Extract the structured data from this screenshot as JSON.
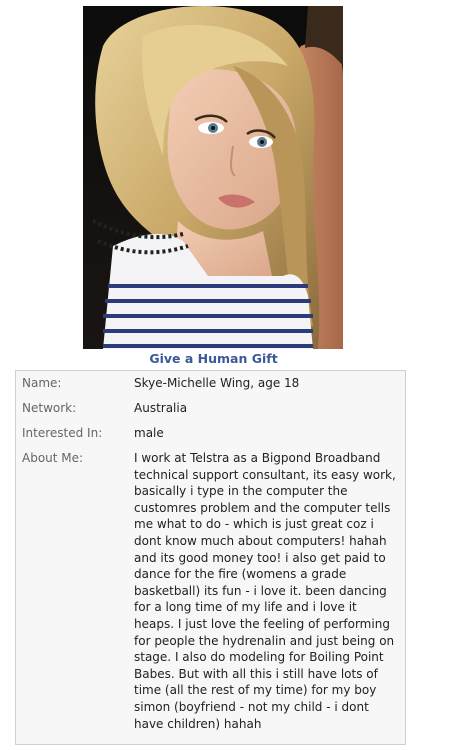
{
  "gift": {
    "label": "Give a Human Gift"
  },
  "profile": {
    "name_label": "Name:",
    "name_value": "Skye-Michelle Wing, age 18",
    "network_label": "Network:",
    "network_value": "Australia",
    "interested_label": "Interested In:",
    "interested_value": "male",
    "about_label": "About Me:",
    "about_value": "I work at Telstra as a Bigpond Broadband technical support consultant, its easy work, basically i type in the computer the customres problem and the computer tells me what to do - which is just great coz i dont know much about computers! hahah and its good money too! i also get paid to dance for the fire (womens a grade basketball) its fun - i love it. been dancing for a long time of my life and i love it heaps. I just love the feeling of performing for people the hydrenalin and just being on stage. I also do modeling for Boiling Point Babes. But with all this i still have lots of time (all the rest of my time) for my boy simon (boyfriend - not my child - i dont have children) hahah"
  },
  "colors": {
    "link": "#3b5998",
    "label": "#666666",
    "panel_bg": "#f7f7f7",
    "panel_border": "#d0d0d0"
  }
}
